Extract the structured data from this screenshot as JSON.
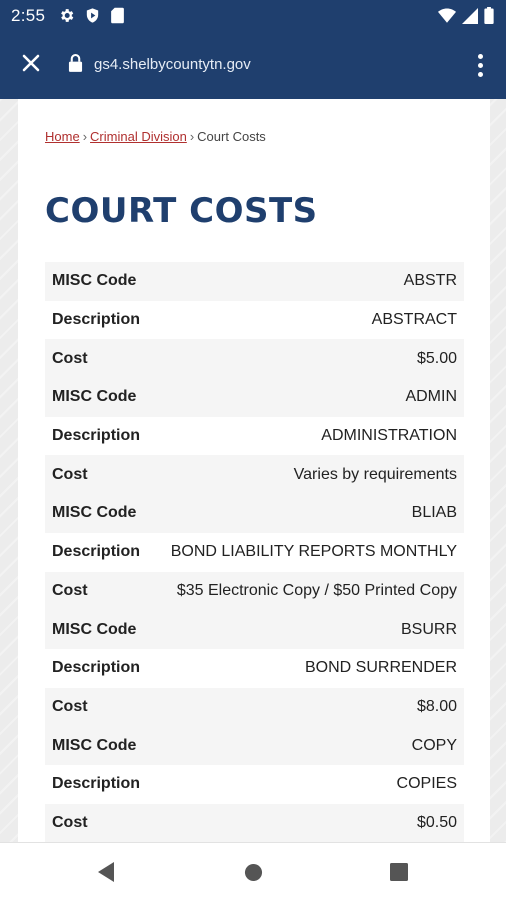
{
  "status_bar": {
    "time": "2:55",
    "left_icons": [
      "gear-icon",
      "shield-icon",
      "sd-card-icon"
    ],
    "right_icons": [
      "wifi-icon",
      "signal-icon",
      "battery-icon"
    ]
  },
  "url_bar": {
    "url": "gs4.shelbycountytn.gov"
  },
  "breadcrumb": {
    "home": "Home",
    "separator": "›",
    "criminal_division": "Criminal Division",
    "current": "Court Costs"
  },
  "page": {
    "title": "COURT COSTS"
  },
  "costs": [
    {
      "code_label": "MISC Code",
      "code": "ABSTR",
      "desc_label": "Description",
      "desc": "ABSTRACT",
      "cost_label": "Cost",
      "cost": "$5.00"
    },
    {
      "code_label": "MISC Code",
      "code": "ADMIN",
      "desc_label": "Description",
      "desc": "ADMINISTRATION",
      "cost_label": "Cost",
      "cost": "Varies by requirements"
    },
    {
      "code_label": "MISC Code",
      "code": "BLIAB",
      "desc_label": "Description",
      "desc": "BOND LIABILITY REPORTS MONTHLY",
      "cost_label": "Cost",
      "cost": "$35 Electronic Copy / $50 Printed Copy"
    },
    {
      "code_label": "MISC Code",
      "code": "BSURR",
      "desc_label": "Description",
      "desc": "BOND SURRENDER",
      "cost_label": "Cost",
      "cost": "$8.00"
    },
    {
      "code_label": "MISC Code",
      "code": "COPY",
      "desc_label": "Description",
      "desc": "COPIES",
      "cost_label": "Cost",
      "cost": "$0.50"
    }
  ],
  "colors": {
    "header_bg": "#1f3f6e",
    "title": "#1f3f6e",
    "link": "#b0302f"
  }
}
